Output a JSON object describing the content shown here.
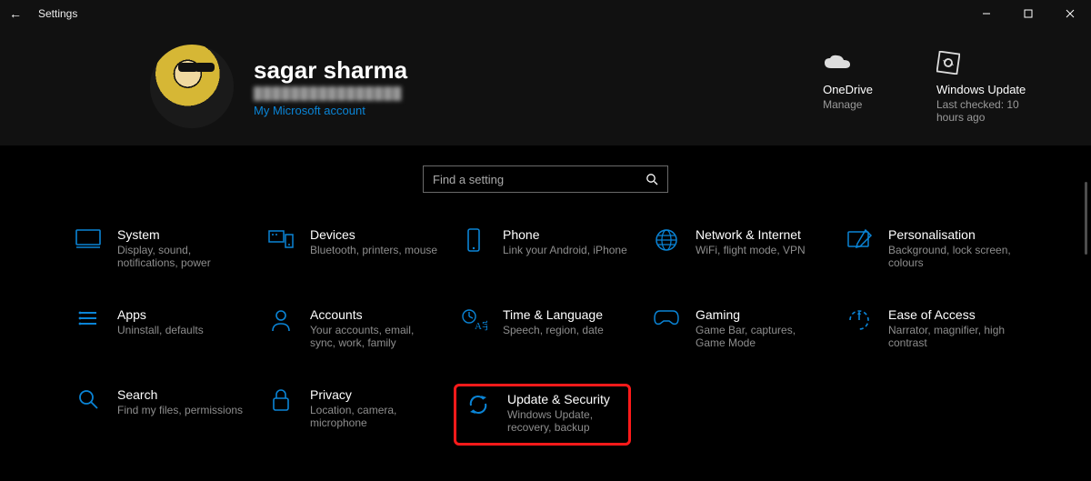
{
  "window": {
    "title": "Settings"
  },
  "user": {
    "name": "sagar sharma",
    "masked_sub": "████████████████",
    "account_link": "My Microsoft account"
  },
  "header_items": [
    {
      "icon": "onedrive-icon",
      "title": "OneDrive",
      "sub": "Manage"
    },
    {
      "icon": "windows-update-icon",
      "title": "Windows Update",
      "sub": "Last checked: 10 hours ago"
    }
  ],
  "search": {
    "placeholder": "Find a setting"
  },
  "tiles": [
    {
      "icon": "system-icon",
      "title": "System",
      "desc": "Display, sound, notifications, power"
    },
    {
      "icon": "devices-icon",
      "title": "Devices",
      "desc": "Bluetooth, printers, mouse"
    },
    {
      "icon": "phone-icon",
      "title": "Phone",
      "desc": "Link your Android, iPhone"
    },
    {
      "icon": "network-icon",
      "title": "Network & Internet",
      "desc": "WiFi, flight mode, VPN"
    },
    {
      "icon": "personalisation-icon",
      "title": "Personalisation",
      "desc": "Background, lock screen, colours"
    },
    {
      "icon": "apps-icon",
      "title": "Apps",
      "desc": "Uninstall, defaults"
    },
    {
      "icon": "accounts-icon",
      "title": "Accounts",
      "desc": "Your accounts, email, sync, work, family"
    },
    {
      "icon": "time-language-icon",
      "title": "Time & Language",
      "desc": "Speech, region, date"
    },
    {
      "icon": "gaming-icon",
      "title": "Gaming",
      "desc": "Game Bar, captures, Game Mode"
    },
    {
      "icon": "ease-of-access-icon",
      "title": "Ease of Access",
      "desc": "Narrator, magnifier, high contrast"
    },
    {
      "icon": "search-cat-icon",
      "title": "Search",
      "desc": "Find my files, permissions"
    },
    {
      "icon": "privacy-icon",
      "title": "Privacy",
      "desc": "Location, camera, microphone"
    },
    {
      "icon": "update-security-icon",
      "title": "Update & Security",
      "desc": "Windows Update, recovery, backup",
      "highlight": true
    }
  ]
}
